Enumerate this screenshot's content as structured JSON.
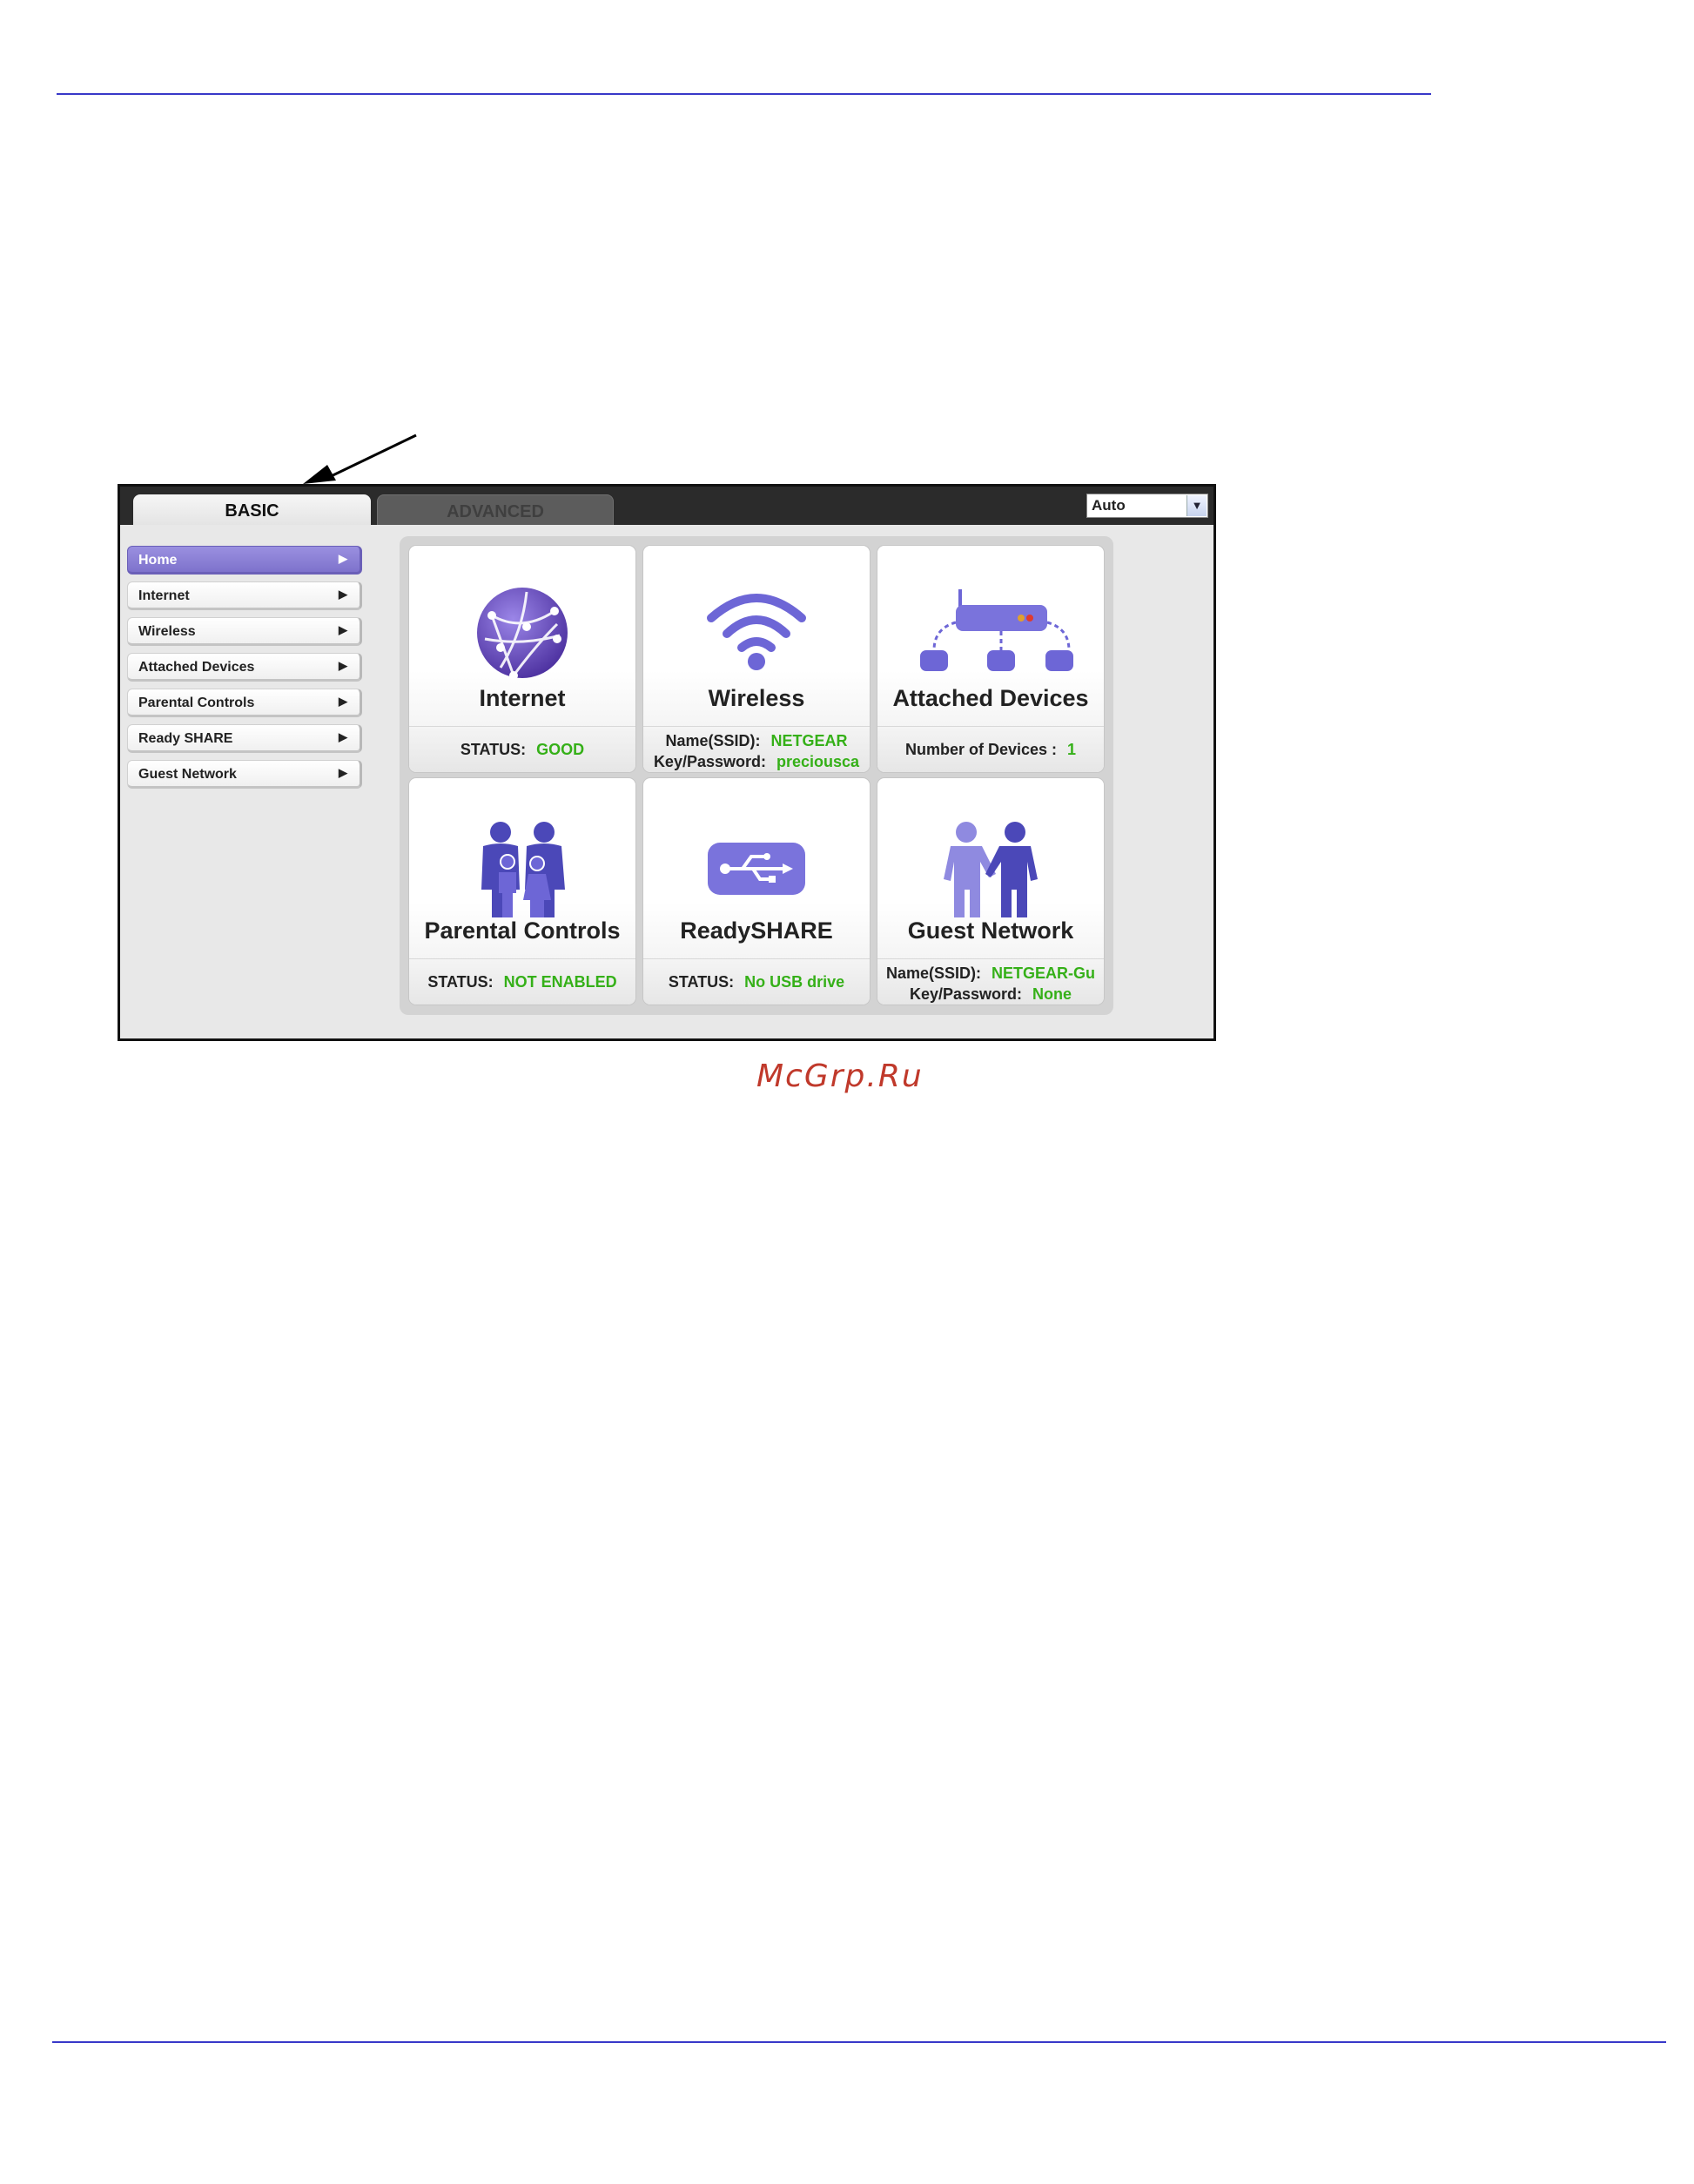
{
  "tabs": {
    "basic": "BASIC",
    "advanced": "ADVANCED"
  },
  "language_select": {
    "value": "Auto"
  },
  "sidebar": {
    "items": [
      {
        "label": "Home",
        "active": true
      },
      {
        "label": "Internet"
      },
      {
        "label": "Wireless"
      },
      {
        "label": "Attached Devices"
      },
      {
        "label": "Parental Controls"
      },
      {
        "label": "Ready SHARE"
      },
      {
        "label": "Guest Network"
      }
    ]
  },
  "tiles": {
    "internet": {
      "title": "Internet",
      "status_label": "STATUS:",
      "status_value": "GOOD"
    },
    "wireless": {
      "title": "Wireless",
      "ssid_label": "Name(SSID):",
      "ssid_value": "NETGEAR",
      "key_label": "Key/Password:",
      "key_value": "preciousca"
    },
    "attached": {
      "title": "Attached Devices",
      "count_label": "Number of Devices :",
      "count_value": "1"
    },
    "parental": {
      "title": "Parental Controls",
      "status_label": "STATUS:",
      "status_value": "NOT ENABLED"
    },
    "readyshare": {
      "title": "ReadySHARE",
      "status_label": "STATUS:",
      "status_value": "No USB drive"
    },
    "guest": {
      "title": "Guest Network",
      "ssid_label": "Name(SSID):",
      "ssid_value": "NETGEAR-Gu",
      "key_label": "Key/Password:",
      "key_value": "None"
    }
  },
  "watermark": "McGrp.Ru",
  "colors": {
    "accent": "#7e72cc",
    "status_green": "#35b018",
    "rule_blue": "#3838c8"
  }
}
